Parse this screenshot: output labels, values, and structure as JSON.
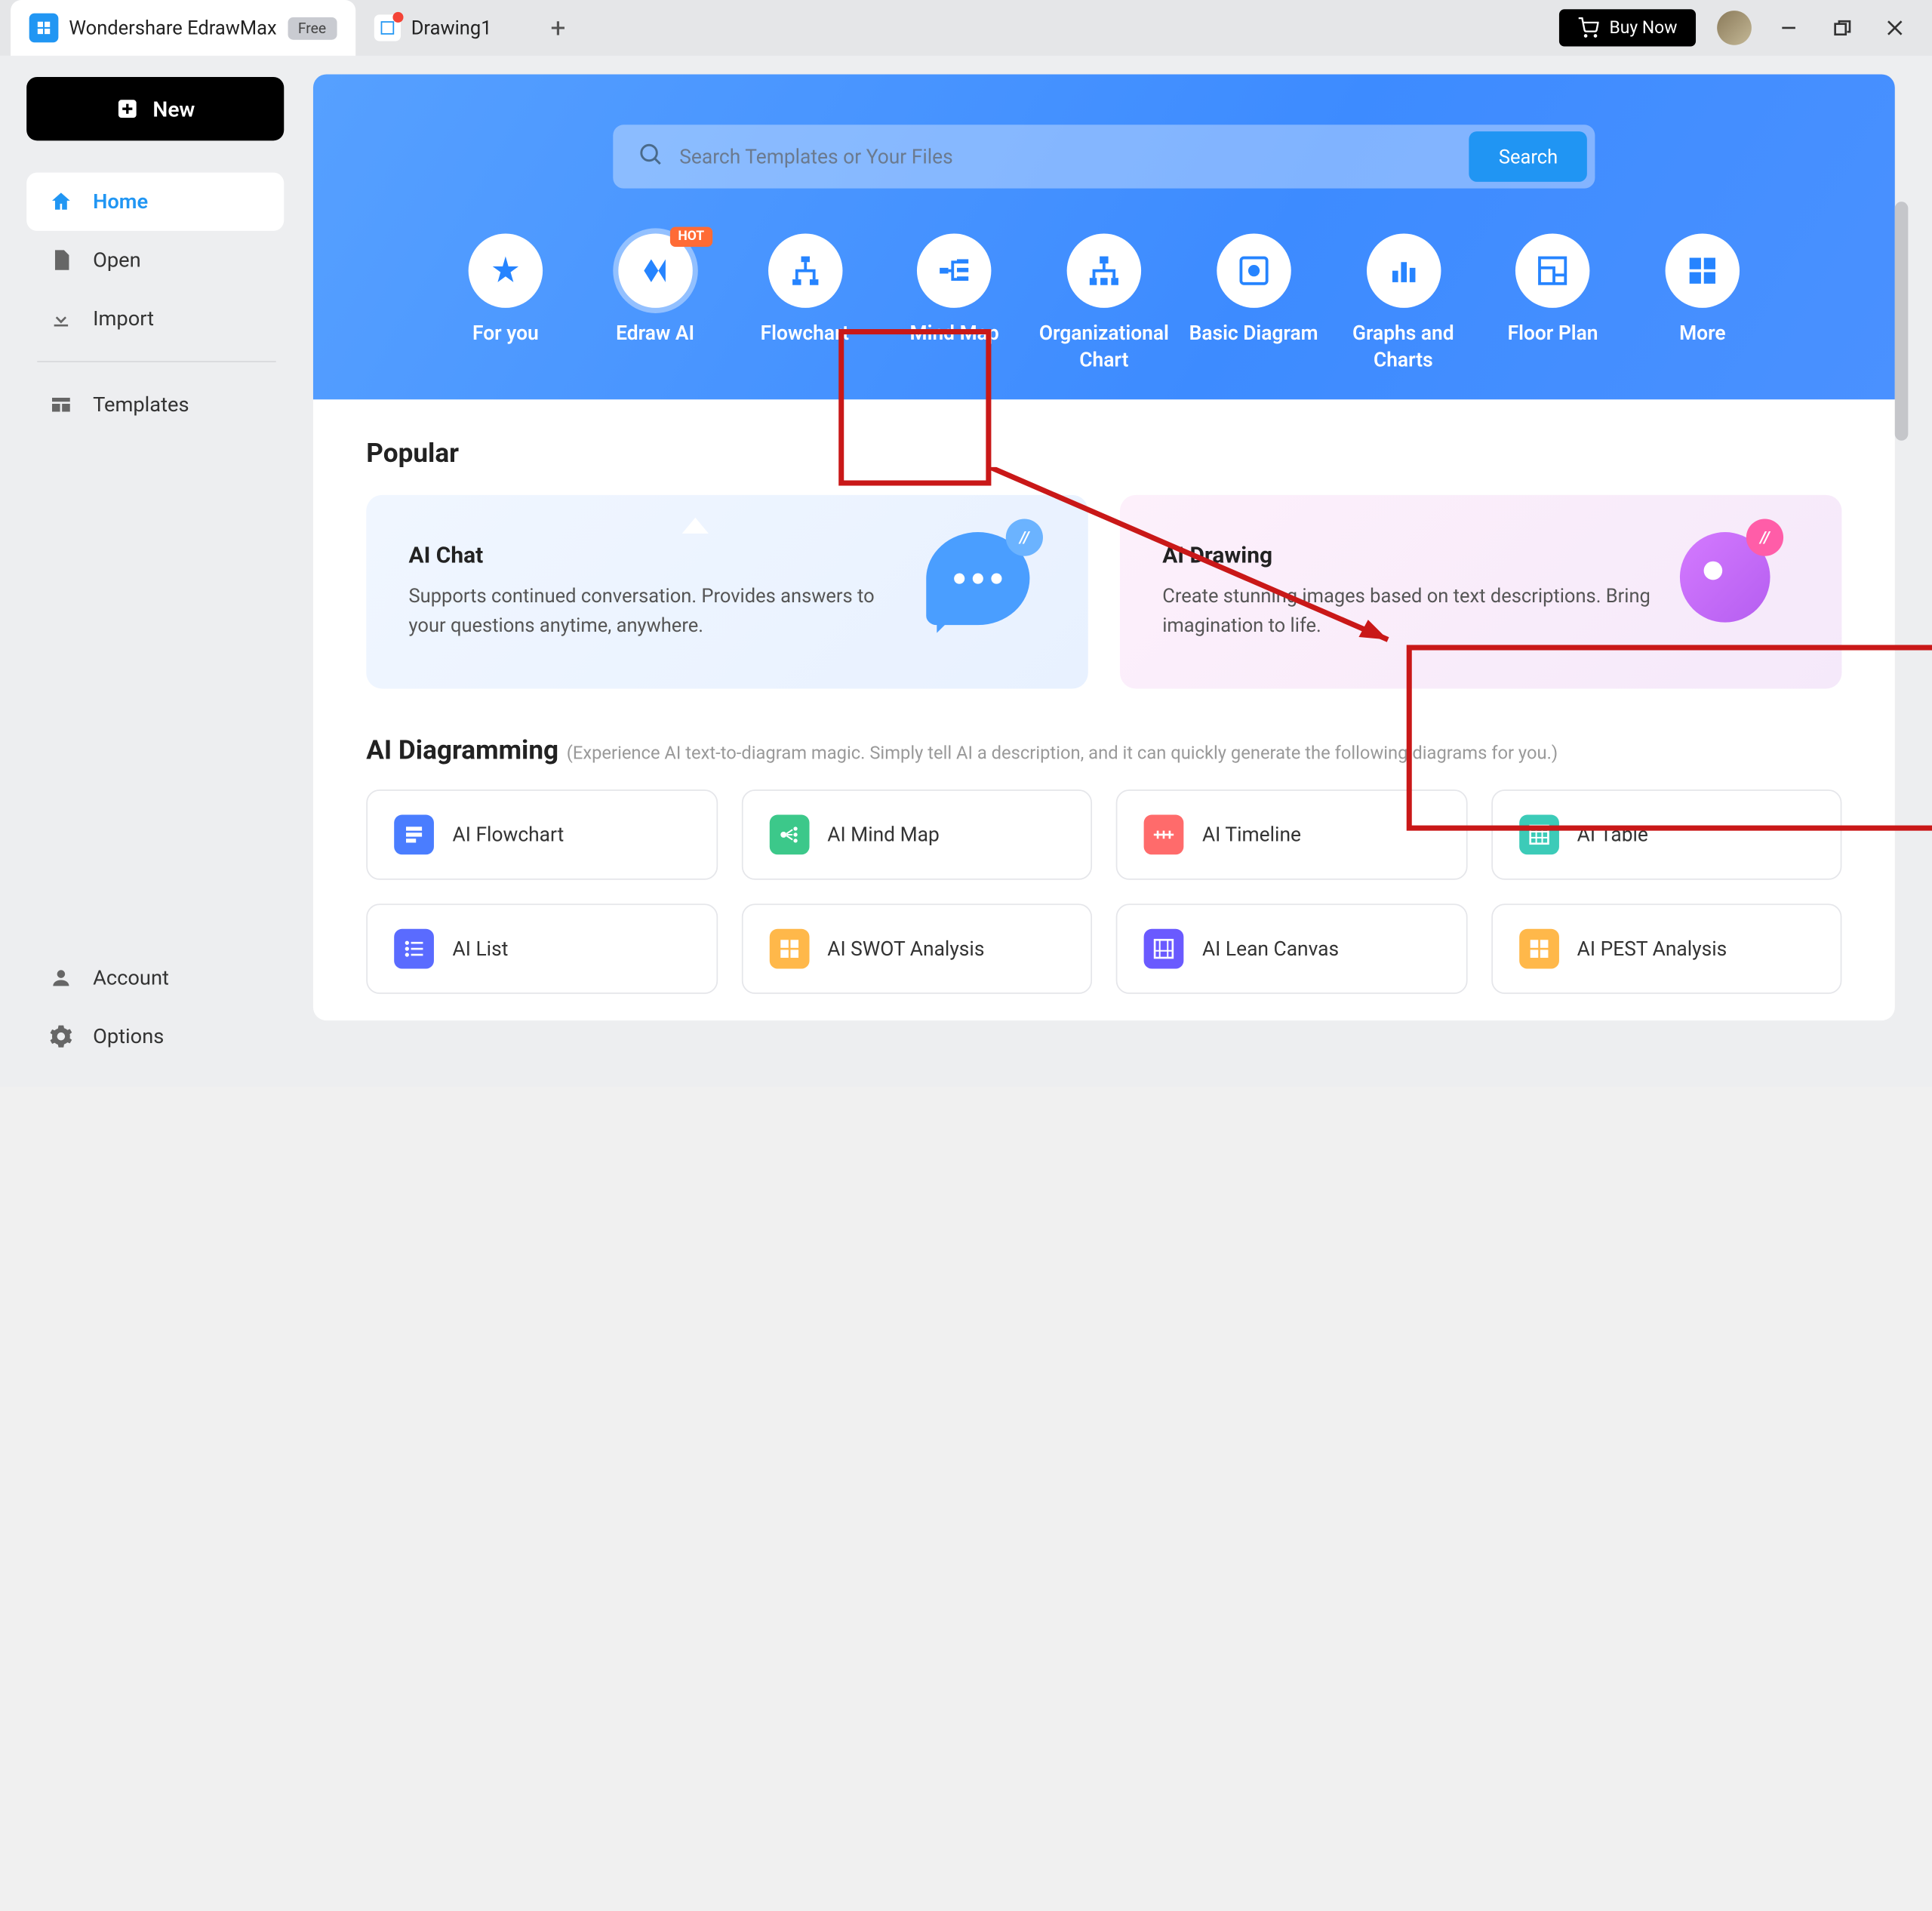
{
  "titlebar": {
    "app_name": "Wondershare EdrawMax",
    "badge": "Free",
    "tab2": "Drawing1",
    "buy": "Buy Now"
  },
  "sidebar": {
    "new": "New",
    "home": "Home",
    "open": "Open",
    "import": "Import",
    "templates": "Templates",
    "account": "Account",
    "options": "Options"
  },
  "search": {
    "placeholder": "Search Templates or Your Files",
    "button": "Search"
  },
  "categories": {
    "foryou": "For you",
    "edrawai": "Edraw AI",
    "hot": "HOT",
    "flowchart": "Flowchart",
    "mindmap": "Mind Map",
    "org": "Organizational Chart",
    "basic": "Basic Diagram",
    "graphs": "Graphs and Charts",
    "floor": "Floor Plan",
    "more": "More"
  },
  "popular": {
    "title": "Popular",
    "chat_title": "AI Chat",
    "chat_desc": "Supports continued conversation. Provides answers to your questions anytime, anywhere.",
    "draw_title": "AI Drawing",
    "draw_desc": "Create stunning images based on text descriptions. Bring imagination to life."
  },
  "aidiag": {
    "title": "AI Diagramming",
    "sub": "(Experience AI text-to-diagram magic.  Simply tell AI a description, and it can quickly generate the following diagrams for you.)",
    "items": [
      "AI Flowchart",
      "AI Mind Map",
      "AI Timeline",
      "AI Table",
      "AI List",
      "AI SWOT Analysis",
      "AI Lean Canvas",
      "AI PEST Analysis"
    ]
  }
}
